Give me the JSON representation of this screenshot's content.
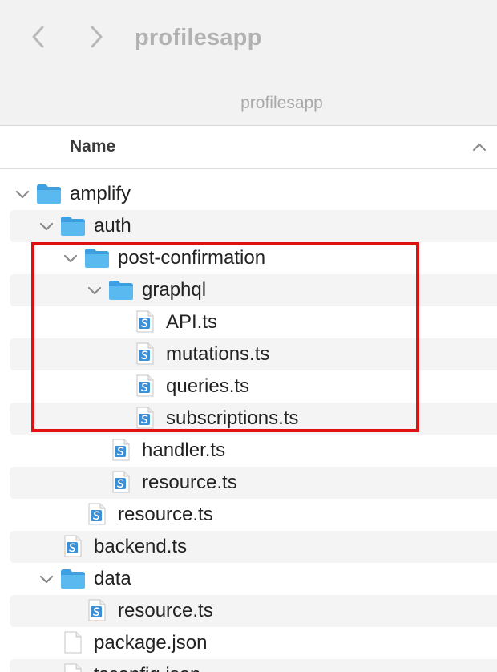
{
  "toolbar": {
    "title": "profilesapp",
    "path_title": "profilesapp",
    "back_icon": "chevron-left-icon",
    "forward_icon": "chevron-right-icon"
  },
  "columns": {
    "name_label": "Name",
    "sort_icon": "chevron-up-icon"
  },
  "colors": {
    "folder": "#5ab9ef",
    "highlight": "#e01010",
    "ts_badge": "#3b8fd6"
  },
  "rows": [
    {
      "label": "amplify",
      "type": "folder",
      "expanded": true
    },
    {
      "label": "auth",
      "type": "folder",
      "expanded": true
    },
    {
      "label": "post-confirmation",
      "type": "folder",
      "expanded": true
    },
    {
      "label": "graphql",
      "type": "folder",
      "expanded": true
    },
    {
      "label": "API.ts",
      "type": "ts-file"
    },
    {
      "label": "mutations.ts",
      "type": "ts-file"
    },
    {
      "label": "queries.ts",
      "type": "ts-file"
    },
    {
      "label": "subscriptions.ts",
      "type": "ts-file"
    },
    {
      "label": "handler.ts",
      "type": "ts-file"
    },
    {
      "label": "resource.ts",
      "type": "ts-file"
    },
    {
      "label": "resource.ts",
      "type": "ts-file"
    },
    {
      "label": "backend.ts",
      "type": "ts-file"
    },
    {
      "label": "data",
      "type": "folder",
      "expanded": true
    },
    {
      "label": "resource.ts",
      "type": "ts-file"
    },
    {
      "label": "package.json",
      "type": "json-file"
    },
    {
      "label": "tsconfig.json",
      "type": "json-file"
    }
  ]
}
